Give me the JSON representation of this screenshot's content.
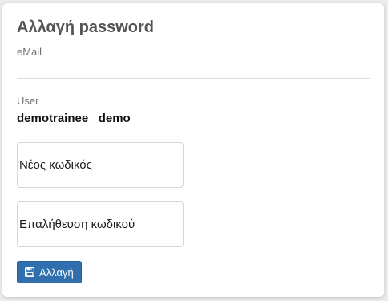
{
  "card": {
    "title": "Αλλαγή password",
    "email_label": "eMail",
    "email_value": "",
    "user_label": "User",
    "user_value": "demotrainee   demo"
  },
  "form": {
    "new_password_placeholder": "Νέος κωδικός",
    "confirm_password_placeholder": "Επαλήθευση κωδικού",
    "submit_label": "Αλλαγή",
    "submit_icon": "save-icon"
  },
  "colors": {
    "primary_button": "#2f6fae",
    "title_text": "#555555",
    "card_background": "#ffffff",
    "page_background": "#ececec"
  }
}
